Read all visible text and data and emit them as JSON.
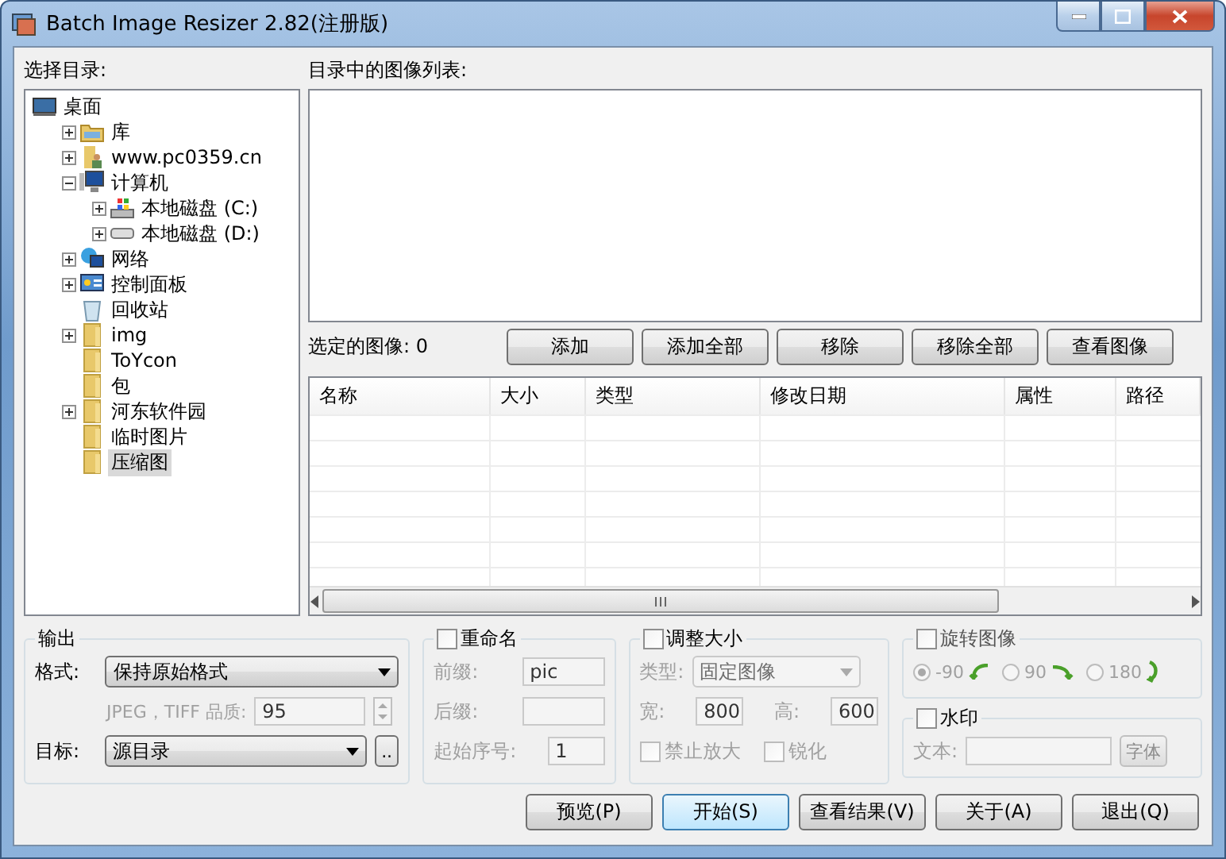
{
  "window": {
    "title": "Batch Image Resizer 2.82(注册版)"
  },
  "folder_panel": {
    "label": "选择目录:",
    "tree": [
      {
        "label": "桌面",
        "kind": "desktop",
        "selected": false,
        "children": [
          {
            "label": "库",
            "kind": "library",
            "expanded": false,
            "selected": false
          },
          {
            "label": "www.pc0359.cn",
            "kind": "user",
            "expanded": false,
            "selected": false
          },
          {
            "label": "计算机",
            "kind": "computer",
            "expanded": true,
            "selected": false,
            "children": [
              {
                "label": "本地磁盘 (C:)",
                "kind": "system-drive",
                "expanded": false,
                "selected": false
              },
              {
                "label": "本地磁盘 (D:)",
                "kind": "drive",
                "expanded": false,
                "selected": false
              }
            ]
          },
          {
            "label": "网络",
            "kind": "network",
            "expanded": false,
            "selected": false
          },
          {
            "label": "控制面板",
            "kind": "control-panel",
            "expanded": false,
            "selected": false
          },
          {
            "label": "回收站",
            "kind": "recycle",
            "selected": false
          },
          {
            "label": "img",
            "kind": "folder",
            "expanded": false,
            "selected": false
          },
          {
            "label": "ToYcon",
            "kind": "folder",
            "selected": false
          },
          {
            "label": "包",
            "kind": "folder",
            "selected": false
          },
          {
            "label": "河东软件园",
            "kind": "folder",
            "expanded": false,
            "selected": false
          },
          {
            "label": "临时图片",
            "kind": "folder",
            "selected": false
          },
          {
            "label": "压缩图",
            "kind": "folder",
            "selected": true
          }
        ]
      }
    ]
  },
  "image_list": {
    "label": "目录中的图像列表:"
  },
  "selected_images": {
    "label": "选定的图像:",
    "count": "0"
  },
  "list_buttons": [
    "添加",
    "添加全部",
    "移除",
    "移除全部",
    "查看图像"
  ],
  "table": {
    "columns": [
      "名称",
      "大小",
      "类型",
      "修改日期",
      "属性",
      "路径"
    ]
  },
  "output": {
    "title": "输出",
    "format": {
      "label": "格式:",
      "value": "保持原始格式"
    },
    "quality": {
      "label": "JPEG，TIFF 品质:",
      "value": "95",
      "disabled": true
    },
    "target": {
      "label": "目标:",
      "value": "源目录",
      "browse": ".."
    }
  },
  "rename": {
    "title": "重命名",
    "checked": false,
    "fields": [
      {
        "label": "前缀:",
        "value": "pic",
        "disabled": true
      },
      {
        "label": "后缀:",
        "disabled": true
      },
      {
        "label": "起始序号:",
        "value": "1",
        "disabled": true
      }
    ]
  },
  "resize": {
    "title": "调整大小",
    "checked": false,
    "disabled": true,
    "type": {
      "label": "类型:",
      "value": "固定图像"
    },
    "width": {
      "label": "宽:",
      "value": "800"
    },
    "height": {
      "label": "高:",
      "value": "600"
    },
    "options": [
      {
        "label": "禁止放大",
        "checked": false
      },
      {
        "label": "锐化",
        "checked": false
      }
    ]
  },
  "rotate": {
    "title": "旋转图像",
    "checked": false,
    "disabled": true,
    "options": [
      {
        "label": "-90",
        "kind": "ccw",
        "selected": true
      },
      {
        "label": "90",
        "kind": "cw",
        "selected": false
      },
      {
        "label": "180",
        "kind": "flip",
        "selected": false
      }
    ]
  },
  "watermark": {
    "title": "水印",
    "checked": false,
    "disabled": true,
    "text_label": "文本:",
    "font_button": "字体"
  },
  "actions": [
    {
      "label": "预览(P)",
      "default": false
    },
    {
      "label": "开始(S)",
      "default": true
    },
    {
      "label": "查看结果(V)",
      "default": false
    },
    {
      "label": "关于(A)",
      "default": false
    },
    {
      "label": "退出(Q)",
      "default": false
    }
  ]
}
